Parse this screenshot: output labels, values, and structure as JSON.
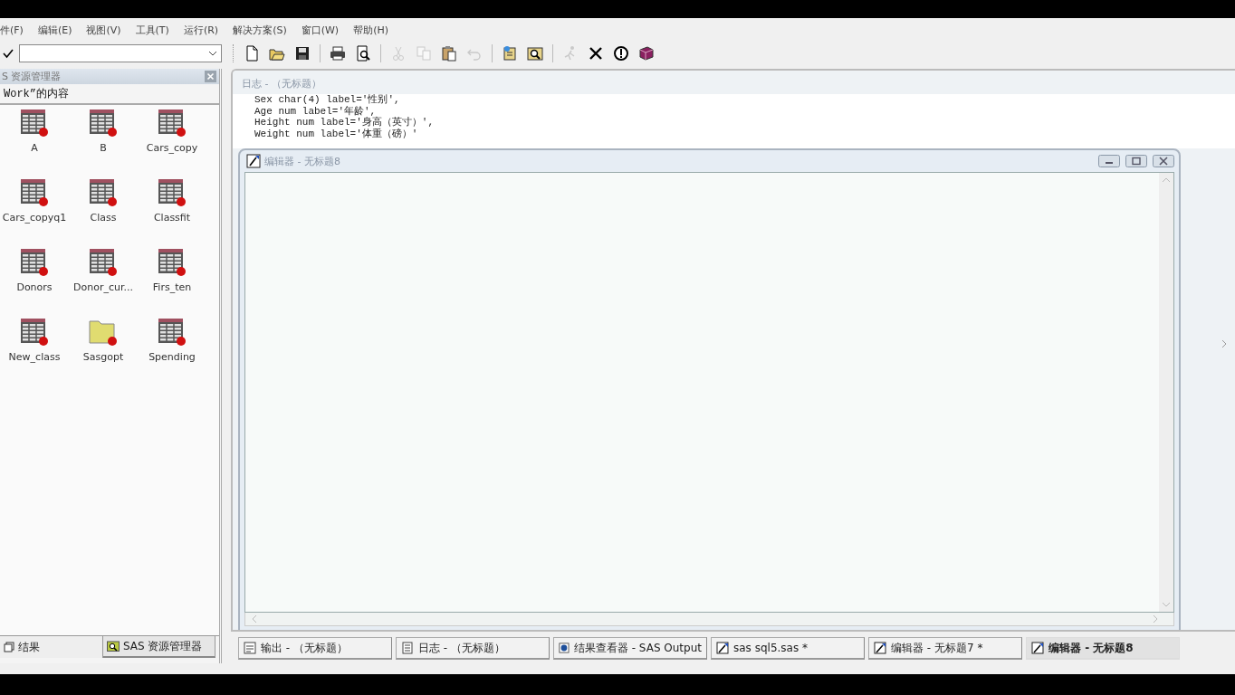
{
  "menu": [
    "件(F)",
    "编辑(E)",
    "视图(V)",
    "工具(T)",
    "运行(R)",
    "解决方案(S)",
    "窗口(W)",
    "帮助(H)"
  ],
  "toolbar": {
    "buttons": [
      {
        "disabled": false
      },
      {
        "disabled": false
      },
      {
        "disabled": false
      },
      {
        "disabled": false
      },
      {
        "disabled": false
      },
      {
        "disabled": true
      },
      {
        "disabled": true
      },
      {
        "disabled": false
      },
      {
        "disabled": true
      },
      {
        "disabled": false
      },
      {
        "disabled": false
      },
      {
        "disabled": true
      },
      {
        "disabled": false
      },
      {
        "disabled": false
      },
      {
        "disabled": false
      }
    ]
  },
  "explorer": {
    "title": "S 资源管理器",
    "subtitle": "Work”的内容",
    "items": [
      {
        "label": "A",
        "kind": "table"
      },
      {
        "label": "B",
        "kind": "table"
      },
      {
        "label": "Cars_copy",
        "kind": "table"
      },
      {
        "label": "Cars_copyq1",
        "kind": "table"
      },
      {
        "label": "Class",
        "kind": "table"
      },
      {
        "label": "Classfit",
        "kind": "table"
      },
      {
        "label": "Donors",
        "kind": "table"
      },
      {
        "label": "Donor_cur...",
        "kind": "table"
      },
      {
        "label": "Firs_ten",
        "kind": "table"
      },
      {
        "label": "New_class",
        "kind": "table"
      },
      {
        "label": "Sasgopt",
        "kind": "folder"
      },
      {
        "label": "Spending",
        "kind": "table"
      }
    ],
    "tabs": [
      {
        "label": "结果",
        "selected": false
      },
      {
        "label": "SAS 资源管理器",
        "selected": true
      }
    ]
  },
  "log_window": {
    "title": "日志 - （无标题）",
    "lines": [
      "Sex char(4) label='性别',",
      "Age num label='年龄',",
      "Height num label='身高（英寸）',",
      "Weight num label='体重（磅）'"
    ]
  },
  "editor_window": {
    "title": "编辑器 - 无标题8"
  },
  "taskbar": [
    {
      "label": "输出 - （无标题）",
      "kind": "output",
      "selected": false
    },
    {
      "label": "日志 - （无标题）",
      "kind": "log",
      "selected": false
    },
    {
      "label": "结果查看器 - SAS Output",
      "kind": "results",
      "selected": false
    },
    {
      "label": "sas sql5.sas *",
      "kind": "editor",
      "selected": false
    },
    {
      "label": "编辑器 - 无标题7 *",
      "kind": "editor",
      "selected": false
    },
    {
      "label": "编辑器 - 无标题8",
      "kind": "editor",
      "selected": true
    }
  ]
}
